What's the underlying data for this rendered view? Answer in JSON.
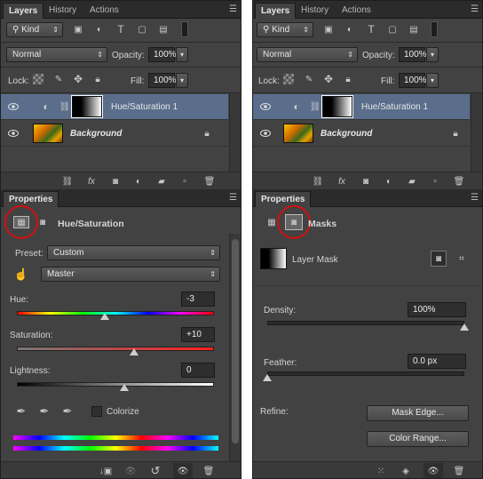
{
  "left": {
    "tabs": [
      "Layers",
      "History",
      "Actions"
    ],
    "filter_kind": "Kind",
    "blend_mode": "Normal",
    "opacity_label": "Opacity:",
    "opacity_value": "100%",
    "lock_label": "Lock:",
    "fill_label": "Fill:",
    "fill_value": "100%",
    "layers": [
      {
        "name": "Hue/Saturation 1",
        "selected": true
      },
      {
        "name": "Background",
        "selected": false
      }
    ],
    "properties_tab": "Properties",
    "properties_title": "Hue/Saturation",
    "preset_label": "Preset:",
    "preset_value": "Custom",
    "channel_value": "Master",
    "hue_label": "Hue:",
    "hue_value": "-3",
    "saturation_label": "Saturation:",
    "saturation_value": "+10",
    "lightness_label": "Lightness:",
    "lightness_value": "0",
    "colorize_label": "Colorize"
  },
  "right": {
    "tabs": [
      "Layers",
      "History",
      "Actions"
    ],
    "filter_kind": "Kind",
    "blend_mode": "Normal",
    "opacity_label": "Opacity:",
    "opacity_value": "100%",
    "lock_label": "Lock:",
    "fill_label": "Fill:",
    "fill_value": "100%",
    "layers": [
      {
        "name": "Hue/Saturation 1",
        "selected": true
      },
      {
        "name": "Background",
        "selected": false
      }
    ],
    "properties_tab": "Properties",
    "properties_title": "Masks",
    "layer_mask_label": "Layer Mask",
    "density_label": "Density:",
    "density_value": "100%",
    "feather_label": "Feather:",
    "feather_value": "0.0 px",
    "refine_label": "Refine:",
    "mask_edge_button": "Mask Edge...",
    "color_range_button": "Color Range..."
  },
  "colors": {
    "panel_bg": "#424242",
    "selected_row": "#5a6e8c",
    "highlight_circle": "#d01010"
  }
}
